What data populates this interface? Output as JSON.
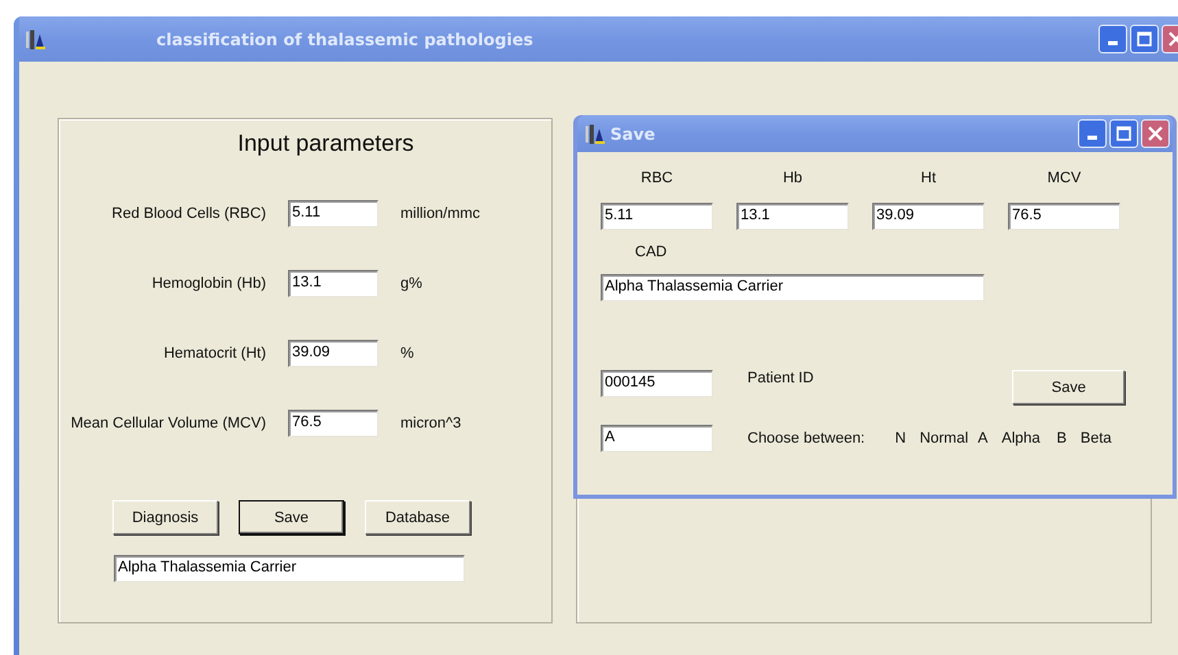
{
  "window": {
    "title": "classification of thalassemic pathologies"
  },
  "input_panel": {
    "heading": "Input parameters",
    "parameters": [
      {
        "label": "Red Blood Cells (RBC)",
        "value": "5.11",
        "unit": "million/mmc"
      },
      {
        "label": "Hemoglobin (Hb)",
        "value": "13.1",
        "unit": "g%"
      },
      {
        "label": "Hematocrit (Ht)",
        "value": "39.09",
        "unit": "%"
      },
      {
        "label": "Mean Cellular Volume (MCV)",
        "value": "76.5",
        "unit": "micron^3"
      }
    ],
    "buttons": [
      {
        "label": "Diagnosis",
        "default": false
      },
      {
        "label": "Save",
        "default": true
      },
      {
        "label": "Database",
        "default": false
      }
    ],
    "result": "Alpha Thalassemia Carrier"
  },
  "save_dialog": {
    "title": "Save",
    "fields": [
      {
        "label": "RBC",
        "value": "5.11"
      },
      {
        "label": "Hb",
        "value": "13.1"
      },
      {
        "label": "Ht",
        "value": "39.09"
      },
      {
        "label": "MCV",
        "value": "76.5"
      }
    ],
    "cad": {
      "label": "CAD",
      "value": "Alpha Thalassemia Carrier"
    },
    "patient_id": {
      "label": "Patient ID",
      "value": "000145"
    },
    "save_button": "Save",
    "category": {
      "value": "A",
      "label": "Choose between:",
      "options": [
        {
          "code": "N",
          "name": "Normal"
        },
        {
          "code": "A",
          "name": "Alpha"
        },
        {
          "code": "B",
          "name": "Beta"
        }
      ]
    }
  }
}
